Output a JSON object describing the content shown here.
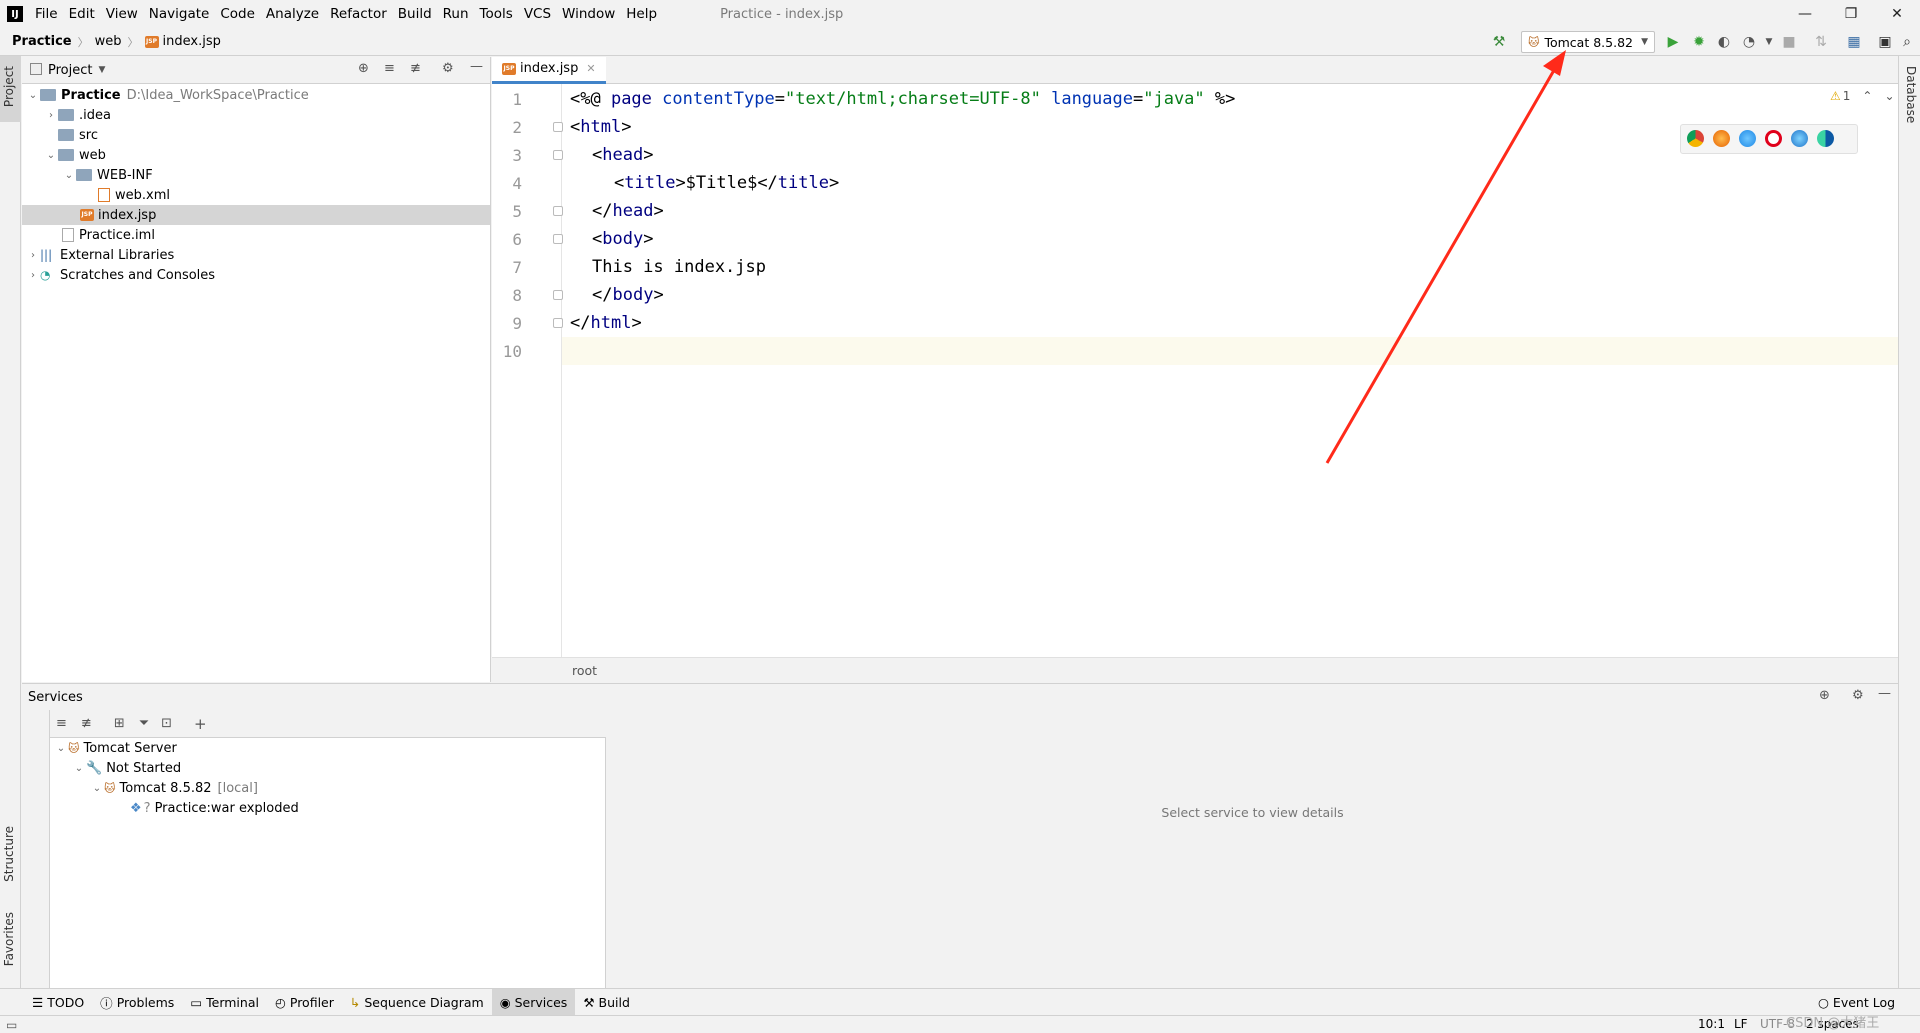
{
  "menubar": {
    "logo": "IJ",
    "items": [
      "File",
      "Edit",
      "View",
      "Navigate",
      "Code",
      "Analyze",
      "Refactor",
      "Build",
      "Run",
      "Tools",
      "VCS",
      "Window",
      "Help"
    ],
    "window_title": "Practice - index.jsp",
    "controls": [
      "—",
      "❐",
      "✕"
    ]
  },
  "navbar": {
    "crumbs": [
      "Practice",
      "web",
      "index.jsp"
    ],
    "run_config": "Tomcat 8.5.82"
  },
  "project": {
    "title": "Project",
    "rows": [
      {
        "label": "Practice",
        "hint": "D:\\Idea_WorkSpace\\Practice"
      },
      {
        "label": ".idea"
      },
      {
        "label": "src"
      },
      {
        "label": "web"
      },
      {
        "label": "WEB-INF"
      },
      {
        "label": "web.xml"
      },
      {
        "label": "index.jsp"
      },
      {
        "label": "Practice.iml"
      },
      {
        "label": "External Libraries"
      },
      {
        "label": "Scratches and Consoles"
      }
    ]
  },
  "editor": {
    "tab": "index.jsp",
    "lines": [
      "1",
      "2",
      "3",
      "4",
      "5",
      "6",
      "7",
      "8",
      "9",
      "10"
    ],
    "warnings": "1",
    "breadcrumb": "root"
  },
  "code": {
    "l1": {
      "a": "<%@ ",
      "b": "page ",
      "c": "contentType",
      "d": "=",
      "e": "\"text/html;charset=UTF-8\"",
      "f": " language",
      "g": "=",
      "h": "\"java\"",
      "i": " %>"
    },
    "l2": {
      "a": "<",
      "b": "html",
      "c": ">"
    },
    "l3": {
      "a": "<",
      "b": "head",
      "c": ">"
    },
    "l4": {
      "a": "<",
      "b": "title",
      "c": ">$Title$</",
      "d": "title",
      "e": ">"
    },
    "l5": {
      "a": "</",
      "b": "head",
      "c": ">"
    },
    "l6": {
      "a": "<",
      "b": "body",
      "c": ">"
    },
    "l7": "This is index.jsp",
    "l8": {
      "a": "</",
      "b": "body",
      "c": ">"
    },
    "l9": {
      "a": "</",
      "b": "html",
      "c": ">"
    }
  },
  "services": {
    "title": "Services",
    "tree": [
      {
        "label": "Tomcat Server"
      },
      {
        "label": "Not Started"
      },
      {
        "label": "Tomcat 8.5.82",
        "hint": "[local]"
      },
      {
        "label": "Practice:war exploded"
      }
    ],
    "detail_hint": "Select service to view details"
  },
  "side_tabs": {
    "project": "Project",
    "structure": "Structure",
    "favorites": "Favorites",
    "database": "Database"
  },
  "bottom_tabs": [
    "TODO",
    "Problems",
    "Terminal",
    "Profiler",
    "Sequence Diagram",
    "Services",
    "Build"
  ],
  "event_log": "Event Log",
  "status": {
    "position": "10:1",
    "line_sep": "LF",
    "encoding": "UTF-8",
    "indent": "2 spaces",
    "watermark": "CSDN @大猪王"
  },
  "colors": {
    "accent": "#4083c9",
    "annotation_arrow": "#ff2a1a",
    "keyword": "#000080",
    "string": "#067d17"
  }
}
